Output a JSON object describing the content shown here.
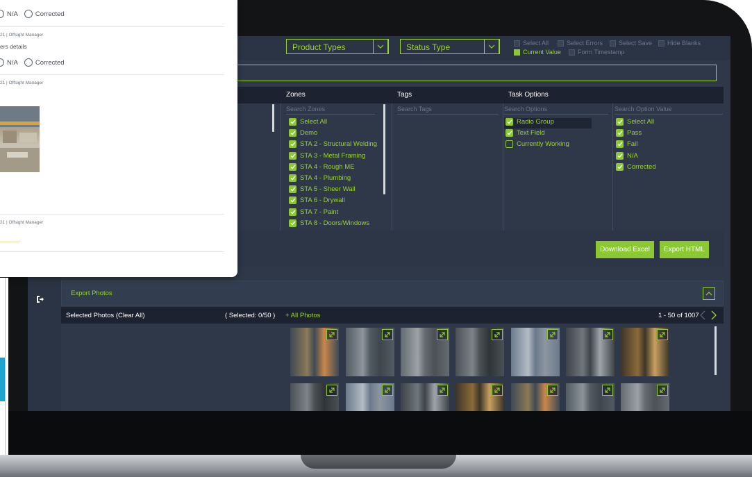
{
  "filters": {
    "product_types": "Product Types",
    "status_type": "Status Type",
    "options_row1": [
      "Select All",
      "Select Errors",
      "Select Save",
      "Hide Blanks"
    ],
    "options_row2": [
      "Current Value",
      "Form Timestamp"
    ]
  },
  "table": {
    "headers": {
      "zones": "Zones",
      "tags": "Tags",
      "task_options": "Task Options"
    },
    "zones": {
      "search_placeholder": "Search Zones",
      "items": [
        "Select All",
        "Demo",
        "STA 2 - Structural Welding",
        "STA 3 - Metal Framing",
        "STA 4 - Rough ME",
        "STA 4 - Plumbing",
        "STA 5 - Sheer Wall",
        "STA 6 - Drywall",
        "STA 7 - Paint",
        "STA 8 - Doors/Windows"
      ]
    },
    "tags": {
      "search_placeholder": "Search Tags"
    },
    "task_options": {
      "search_placeholder": "Search Options",
      "items": [
        {
          "label": "Radio Group",
          "checked": true
        },
        {
          "label": "Text Field",
          "checked": true
        },
        {
          "label": "Currently Working",
          "checked": false
        }
      ]
    },
    "option_values": {
      "search_placeholder": "Search Option Value",
      "items": [
        "Select All",
        "Pass",
        "Fail",
        "N/A",
        "Corrected"
      ]
    }
  },
  "buttons": {
    "download_excel": "Download Excel",
    "export_html": "Export HTML"
  },
  "export_photos": {
    "title": "Export Photos",
    "selected_label": "Selected Photos (Clear All)",
    "selected_count": "( Selected: 0/50 )",
    "all_photos": "+ All Photos",
    "pagination": "1 - 50 of 1007"
  },
  "overlay": {
    "row1": {
      "na": "N/A",
      "corrected": "Corrected"
    },
    "meta1": "21 | Offsight Manager",
    "details_text": "ers details",
    "row2": {
      "na": "N/A",
      "corrected": "Corrected"
    },
    "meta2": "21 | Offsight Manager",
    "meta3": "21 | Offsight Manager"
  },
  "colors": {
    "accent": "#8bc832",
    "panel": "#2e3848",
    "header": "#1c2230"
  }
}
